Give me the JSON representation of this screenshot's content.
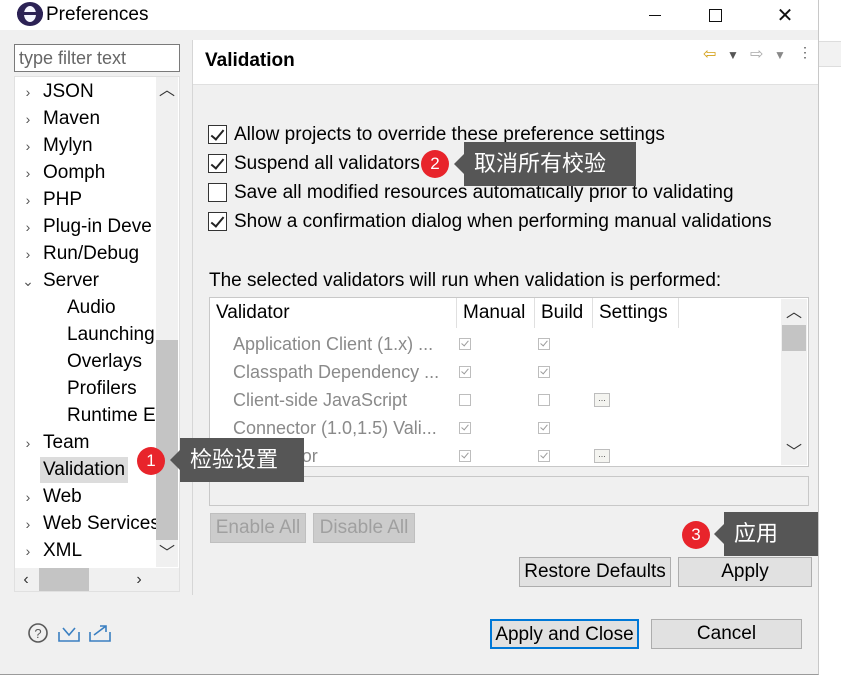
{
  "window": {
    "title": "Preferences",
    "minimize_icon": "minimize-icon",
    "maximize_icon": "maximize-icon",
    "close_label": "✕"
  },
  "sidebar": {
    "filter_placeholder": "type filter text",
    "items": [
      {
        "label": "JSON",
        "arrow": "›",
        "indent": 0
      },
      {
        "label": "Maven",
        "arrow": "›",
        "indent": 0
      },
      {
        "label": "Mylyn",
        "arrow": "›",
        "indent": 0
      },
      {
        "label": "Oomph",
        "arrow": "›",
        "indent": 0
      },
      {
        "label": "PHP",
        "arrow": "›",
        "indent": 0
      },
      {
        "label": "Plug-in Deve",
        "arrow": "›",
        "indent": 0
      },
      {
        "label": "Run/Debug",
        "arrow": "›",
        "indent": 0
      },
      {
        "label": "Server",
        "arrow": "⌄",
        "indent": 0
      },
      {
        "label": "Audio",
        "arrow": "",
        "indent": 1
      },
      {
        "label": "Launching",
        "arrow": "",
        "indent": 1
      },
      {
        "label": "Overlays",
        "arrow": "",
        "indent": 1
      },
      {
        "label": "Profilers",
        "arrow": "",
        "indent": 1
      },
      {
        "label": "Runtime E",
        "arrow": "",
        "indent": 1
      },
      {
        "label": "Team",
        "arrow": "›",
        "indent": 0
      },
      {
        "label": "Validation",
        "arrow": "",
        "indent": 0,
        "selected": true
      },
      {
        "label": "Web",
        "arrow": "›",
        "indent": 0
      },
      {
        "label": "Web Services",
        "arrow": "›",
        "indent": 0
      },
      {
        "label": "XML",
        "arrow": "›",
        "indent": 0
      }
    ]
  },
  "page": {
    "title": "Validation",
    "options": [
      {
        "label": "Allow projects to override these preference settings",
        "checked": true
      },
      {
        "label": "Suspend all validators",
        "checked": true
      },
      {
        "label": "Save all modified resources automatically prior to validating",
        "checked": false
      },
      {
        "label": "Show a confirmation dialog when performing manual validations",
        "checked": true
      }
    ],
    "validators_caption": "The selected validators will run when validation is performed:",
    "table": {
      "headers": [
        "Validator",
        "Manual",
        "Build",
        "Settings"
      ],
      "rows": [
        {
          "name": "Application Client (1.x) ...",
          "manual": true,
          "build": true,
          "settings": false
        },
        {
          "name": "Classpath Dependency ...",
          "manual": true,
          "build": true,
          "settings": false
        },
        {
          "name": "Client-side JavaScript",
          "manual": false,
          "build": false,
          "settings": true
        },
        {
          "name": "Connector (1.0,1.5) Vali...",
          "manual": true,
          "build": true,
          "settings": false
        },
        {
          "name": "...Validator",
          "manual": true,
          "build": true,
          "settings": true
        }
      ]
    },
    "enable_all": "Enable All",
    "disable_all": "Disable All",
    "restore_defaults": "Restore Defaults",
    "apply": "Apply"
  },
  "footer": {
    "apply_and_close": "Apply and Close",
    "cancel": "Cancel"
  },
  "annotations": [
    {
      "number": "1",
      "text": "检验设置"
    },
    {
      "number": "2",
      "text": "取消所有校验"
    },
    {
      "number": "3",
      "text": "应用"
    }
  ],
  "colors": {
    "badge": "#e8242b",
    "callout": "#565656",
    "accent": "#0078d7"
  }
}
